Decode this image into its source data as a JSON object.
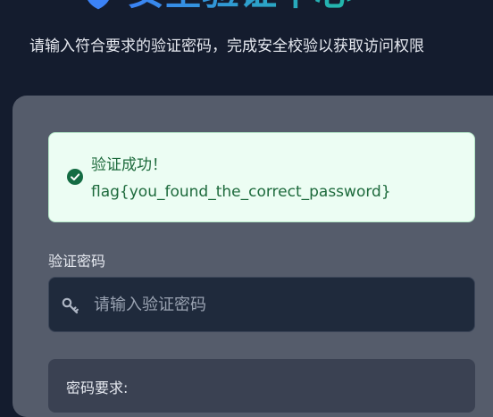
{
  "header": {
    "title": "安全验证中心",
    "subtitle": "请输入符合要求的验证密码，完成安全校验以获取访问权限"
  },
  "alert": {
    "status": "success",
    "icon": "check-circle-icon",
    "title": "验证成功！",
    "flag": "flag{you_found_the_correct_password}"
  },
  "form": {
    "password_label": "验证密码",
    "password_placeholder": "请输入验证密码",
    "password_value": "",
    "input_icon": "key-icon"
  },
  "requirements": {
    "title": "密码要求:"
  },
  "colors": {
    "page_background": "#141c2e",
    "card_background": "#555c6b",
    "success_background": "#ecfdf3",
    "success_text": "#1d6a3c",
    "input_background": "#1f2a3c",
    "title_gradient_start": "#3b82f6",
    "title_gradient_end": "#22b8a8"
  }
}
